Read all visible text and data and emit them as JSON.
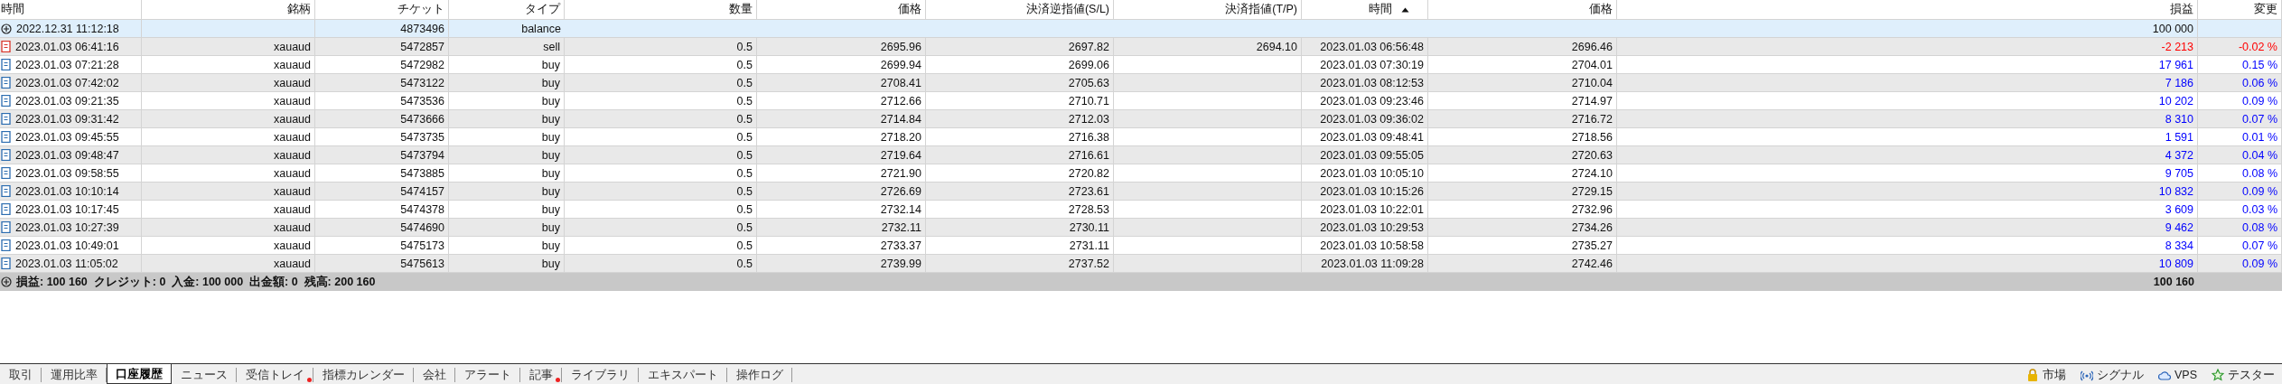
{
  "table": {
    "columns": [
      {
        "label": "時間",
        "sorted": false
      },
      {
        "label": "銘柄",
        "sorted": false
      },
      {
        "label": "チケット",
        "sorted": false
      },
      {
        "label": "タイプ",
        "sorted": false
      },
      {
        "label": "数量",
        "sorted": false
      },
      {
        "label": "価格",
        "sorted": false
      },
      {
        "label": "決済逆指値(S/L)",
        "sorted": false
      },
      {
        "label": "決済指値(T/P)",
        "sorted": false
      },
      {
        "label": "時間",
        "sorted": true
      },
      {
        "label": "価格",
        "sorted": false
      },
      {
        "label": "損益",
        "sorted": false
      },
      {
        "label": "変更",
        "sorted": false
      }
    ],
    "balance_row": {
      "time": "2022.12.31 11:12:18",
      "ticket": "4873496",
      "type": "balance",
      "profit": "100 000"
    },
    "rows": [
      {
        "kind": "sell",
        "time": "2023.01.03 06:41:16",
        "symbol": "xauaud",
        "ticket": "5472857",
        "type": "sell",
        "volume": "0.5",
        "price": "2695.96",
        "sl": "2697.82",
        "tp": "2694.10",
        "close_time": "2023.01.03 06:56:48",
        "close_price": "2696.46",
        "profit": "-2 213",
        "change": "-0.02 %",
        "color": "#ff0000"
      },
      {
        "kind": "buy",
        "time": "2023.01.03 07:21:28",
        "symbol": "xauaud",
        "ticket": "5472982",
        "type": "buy",
        "volume": "0.5",
        "price": "2699.94",
        "sl": "2699.06",
        "close_time": "2023.01.03 07:30:19",
        "close_price": "2704.01",
        "profit": "17 961",
        "change": "0.15 %",
        "color": "#0000ff"
      },
      {
        "kind": "buy",
        "time": "2023.01.03 07:42:02",
        "symbol": "xauaud",
        "ticket": "5473122",
        "type": "buy",
        "volume": "0.5",
        "price": "2708.41",
        "sl": "2705.63",
        "close_time": "2023.01.03 08:12:53",
        "close_price": "2710.04",
        "profit": "7 186",
        "change": "0.06 %",
        "color": "#0000ff"
      },
      {
        "kind": "buy",
        "time": "2023.01.03 09:21:35",
        "symbol": "xauaud",
        "ticket": "5473536",
        "type": "buy",
        "volume": "0.5",
        "price": "2712.66",
        "sl": "2710.71",
        "close_time": "2023.01.03 09:23:46",
        "close_price": "2714.97",
        "profit": "10 202",
        "change": "0.09 %",
        "color": "#0000ff"
      },
      {
        "kind": "buy",
        "time": "2023.01.03 09:31:42",
        "symbol": "xauaud",
        "ticket": "5473666",
        "type": "buy",
        "volume": "0.5",
        "price": "2714.84",
        "sl": "2712.03",
        "close_time": "2023.01.03 09:36:02",
        "close_price": "2716.72",
        "profit": "8 310",
        "change": "0.07 %",
        "color": "#0000ff"
      },
      {
        "kind": "buy",
        "time": "2023.01.03 09:45:55",
        "symbol": "xauaud",
        "ticket": "5473735",
        "type": "buy",
        "volume": "0.5",
        "price": "2718.20",
        "sl": "2716.38",
        "close_time": "2023.01.03 09:48:41",
        "close_price": "2718.56",
        "profit": "1 591",
        "change": "0.01 %",
        "color": "#0000ff"
      },
      {
        "kind": "buy",
        "time": "2023.01.03 09:48:47",
        "symbol": "xauaud",
        "ticket": "5473794",
        "type": "buy",
        "volume": "0.5",
        "price": "2719.64",
        "sl": "2716.61",
        "close_time": "2023.01.03 09:55:05",
        "close_price": "2720.63",
        "profit": "4 372",
        "change": "0.04 %",
        "color": "#0000ff"
      },
      {
        "kind": "buy",
        "time": "2023.01.03 09:58:55",
        "symbol": "xauaud",
        "ticket": "5473885",
        "type": "buy",
        "volume": "0.5",
        "price": "2721.90",
        "sl": "2720.82",
        "close_time": "2023.01.03 10:05:10",
        "close_price": "2724.10",
        "profit": "9 705",
        "change": "0.08 %",
        "color": "#0000ff"
      },
      {
        "kind": "buy",
        "time": "2023.01.03 10:10:14",
        "symbol": "xauaud",
        "ticket": "5474157",
        "type": "buy",
        "volume": "0.5",
        "price": "2726.69",
        "sl": "2723.61",
        "close_time": "2023.01.03 10:15:26",
        "close_price": "2729.15",
        "profit": "10 832",
        "change": "0.09 %",
        "color": "#0000ff"
      },
      {
        "kind": "buy",
        "time": "2023.01.03 10:17:45",
        "symbol": "xauaud",
        "ticket": "5474378",
        "type": "buy",
        "volume": "0.5",
        "price": "2732.14",
        "sl": "2728.53",
        "close_time": "2023.01.03 10:22:01",
        "close_price": "2732.96",
        "profit": "3 609",
        "change": "0.03 %",
        "color": "#0000ff"
      },
      {
        "kind": "buy",
        "time": "2023.01.03 10:27:39",
        "symbol": "xauaud",
        "ticket": "5474690",
        "type": "buy",
        "volume": "0.5",
        "price": "2732.11",
        "sl": "2730.11",
        "close_time": "2023.01.03 10:29:53",
        "close_price": "2734.26",
        "profit": "9 462",
        "change": "0.08 %",
        "color": "#0000ff"
      },
      {
        "kind": "buy",
        "time": "2023.01.03 10:49:01",
        "symbol": "xauaud",
        "ticket": "5475173",
        "type": "buy",
        "volume": "0.5",
        "price": "2733.37",
        "sl": "2731.11",
        "close_time": "2023.01.03 10:58:58",
        "close_price": "2735.27",
        "profit": "8 334",
        "change": "0.07 %",
        "color": "#0000ff"
      },
      {
        "kind": "buy",
        "time": "2023.01.03 11:05:02",
        "symbol": "xauaud",
        "ticket": "5475613",
        "type": "buy",
        "volume": "0.5",
        "price": "2739.99",
        "sl": "2737.52",
        "close_time": "2023.01.03 11:09:28",
        "close_price": "2742.46",
        "profit": "10 809",
        "change": "0.09 %",
        "color": "#0000ff"
      }
    ],
    "summary": {
      "text": "損益: 100 160  クレジット: 0  入金: 100 000  出金額: 0  残高: 200 160",
      "profit": "100 160"
    }
  },
  "bottom_tabs": [
    {
      "label": "取引",
      "selected": false,
      "badge": false
    },
    {
      "label": "運用比率",
      "selected": false,
      "badge": false
    },
    {
      "label": "口座履歴",
      "selected": true,
      "badge": false
    },
    {
      "label": "ニュース",
      "selected": false,
      "badge": false
    },
    {
      "label": "受信トレイ",
      "selected": false,
      "badge": true
    },
    {
      "label": "指標カレンダー",
      "selected": false,
      "badge": false
    },
    {
      "label": "会社",
      "selected": false,
      "badge": false
    },
    {
      "label": "アラート",
      "selected": false,
      "badge": false
    },
    {
      "label": "記事",
      "selected": false,
      "badge": true
    },
    {
      "label": "ライブラリ",
      "selected": false,
      "badge": false
    },
    {
      "label": "エキスパート",
      "selected": false,
      "badge": false
    },
    {
      "label": "操作ログ",
      "selected": false,
      "badge": false
    }
  ],
  "right_links": [
    {
      "kind": "lock",
      "label": "市場"
    },
    {
      "kind": "signal",
      "label": "シグナル"
    },
    {
      "kind": "cloud",
      "label": "VPS"
    },
    {
      "kind": "star",
      "label": "テスター"
    }
  ]
}
